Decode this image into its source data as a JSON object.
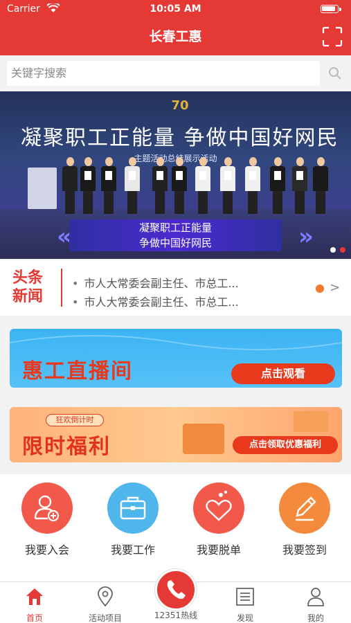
{
  "status": {
    "carrier": "Carrier",
    "time": "10:05 AM"
  },
  "header": {
    "title": "长春工惠"
  },
  "search": {
    "placeholder": "关键字搜索"
  },
  "banner": {
    "logo": "70",
    "headline": "凝聚职工正能量 争做中国好网民",
    "subtitle": "主题活动总结展示活动",
    "slogan_line1": "凝聚职工正能量",
    "slogan_line2": "争做中国好网民"
  },
  "news": {
    "tag_line1": "头条",
    "tag_line2": "新闻",
    "items": [
      "市人大常委会副主任、市总工...",
      "市人大常委会副主任、市总工..."
    ],
    "arrow": ">"
  },
  "promo_live": {
    "title": "惠工直播间",
    "button": "点击观看"
  },
  "promo_welfare": {
    "tag": "狂欢倒计时",
    "title": "限时福利",
    "button": "点击领取优惠福利"
  },
  "actions": [
    {
      "label": "我要入会",
      "icon": "user-add-icon",
      "color": "#f2594b"
    },
    {
      "label": "我要工作",
      "icon": "briefcase-icon",
      "color": "#4fb6ec"
    },
    {
      "label": "我要脱单",
      "icon": "hearts-icon",
      "color": "#f2594b"
    },
    {
      "label": "我要签到",
      "icon": "pencil-icon",
      "color": "#f48a3c"
    }
  ],
  "tabs": [
    {
      "label": "首页",
      "icon": "home-icon"
    },
    {
      "label": "活动项目",
      "icon": "location-pin-icon"
    },
    {
      "label": "12351热线",
      "icon": "phone-icon"
    },
    {
      "label": "发现",
      "icon": "list-icon"
    },
    {
      "label": "我的",
      "icon": "person-icon"
    }
  ],
  "colors": {
    "brand": "#e53935",
    "active_tab": "#e53935"
  }
}
